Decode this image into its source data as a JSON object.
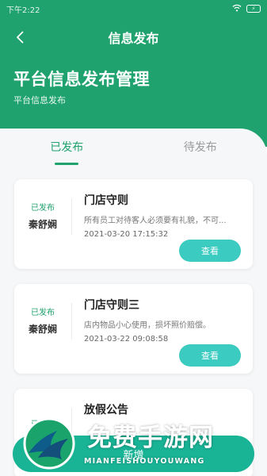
{
  "status_bar": {
    "time": "下午2:22",
    "battery": "⚡"
  },
  "nav": {
    "title": "信息发布"
  },
  "header": {
    "title": "平台信息发布管理",
    "subtitle": "平台信息发布"
  },
  "tabs": [
    {
      "label": "已发布",
      "active": true
    },
    {
      "label": "待发布",
      "active": false
    }
  ],
  "cards": [
    {
      "status": "已发布",
      "author": "秦舒娴",
      "title": "门店守则",
      "desc": "所有员工对待客人必须要有礼貌，不可...",
      "time": "2021-03-20 17:15:32",
      "button": "查看"
    },
    {
      "status": "已发布",
      "author": "秦舒娴",
      "title": "门店守则三",
      "desc": "店内物品小心使用，损坏照价赔偿。",
      "time": "2021-03-22 09:08:58",
      "button": "查看"
    },
    {
      "status": "已发布",
      "author": "",
      "title": "放假公告",
      "desc": "",
      "time": "",
      "button": ""
    }
  ],
  "add_button": {
    "label": "新增"
  },
  "watermark": {
    "text": "免费手游网",
    "sub": "MIANFEISHOUYOUWANG"
  },
  "colors": {
    "primary": "#1fa26d",
    "button": "#3ccbc0",
    "add": "#19b396"
  },
  "icons": {
    "back": "chevron-left-icon",
    "wifi": "wifi-icon",
    "battery": "battery-icon"
  }
}
